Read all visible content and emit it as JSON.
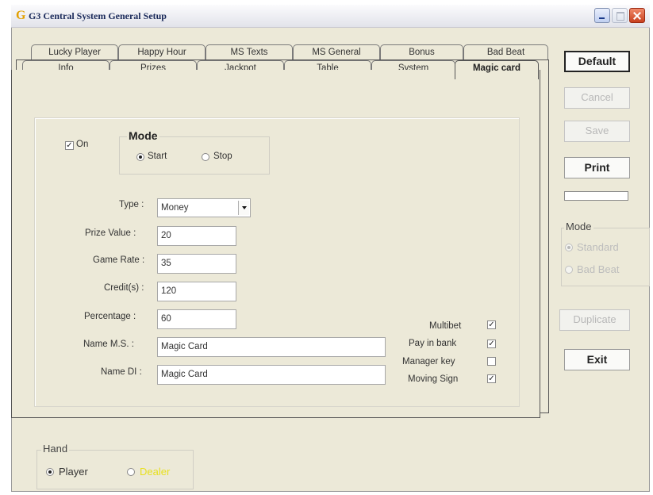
{
  "window": {
    "title": "G3 Central System General Setup",
    "icon_glyph": "G"
  },
  "tabs_back": [
    "Lucky Player",
    "Happy Hour",
    "MS Texts",
    "MS General",
    "Bonus",
    "Bad Beat"
  ],
  "tabs_front": [
    "Info",
    "Prizes",
    "Jackpot",
    "Table",
    "System",
    "Magic card"
  ],
  "active_tab": "Magic card",
  "magic_card": {
    "on_label": "On",
    "on_checked": true,
    "mode": {
      "title": "Mode",
      "start_label": "Start",
      "stop_label": "Stop",
      "selected": "Start"
    },
    "type_label": "Type :",
    "type_value": "Money",
    "prize_value_label": "Prize Value :",
    "prize_value": "20",
    "game_rate_label": "Game Rate :",
    "game_rate": "35",
    "credits_label": "Credit(s) :",
    "credits": "120",
    "percentage_label": "Percentage :",
    "percentage": "60",
    "name_ms_label": "Name M.S. :",
    "name_ms": "Magic Card",
    "name_di_label": "Name DI :",
    "name_di": "Magic Card",
    "multibet_label": "Multibet",
    "multibet": true,
    "pay_in_bank_label": "Pay in bank",
    "pay_in_bank": true,
    "manager_key_label": "Manager key",
    "manager_key": false,
    "moving_sign_label": "Moving Sign",
    "moving_sign": true
  },
  "buttons": {
    "default": "Default",
    "cancel": "Cancel",
    "save": "Save",
    "print": "Print",
    "duplicate": "Duplicate",
    "exit": "Exit"
  },
  "side_mode": {
    "title": "Mode",
    "standard": "Standard",
    "bad_beat": "Bad Beat",
    "selected": "Standard"
  },
  "hand": {
    "title": "Hand",
    "player": "Player",
    "dealer": "Dealer",
    "selected": "Player"
  },
  "colors": {
    "title_text": "#1a2a5a",
    "dealer_text": "#e8e020",
    "disabled_text": "#bdbdbd"
  }
}
